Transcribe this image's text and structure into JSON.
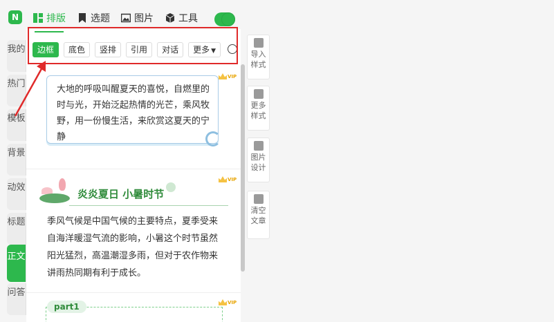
{
  "topbar": {
    "logo": "N",
    "tabs": [
      {
        "label": "排版",
        "icon": "layout-icon",
        "active": true
      },
      {
        "label": "选题",
        "icon": "bookmark-icon",
        "active": false
      },
      {
        "label": "图片",
        "icon": "image-icon",
        "active": false
      },
      {
        "label": "工具",
        "icon": "cube-icon",
        "active": false
      }
    ],
    "toggle_on": true
  },
  "vtabs": [
    {
      "label": "我的",
      "active": false
    },
    {
      "label": "热门",
      "active": false
    },
    {
      "label": "模板",
      "active": false
    },
    {
      "label": "背景",
      "active": false
    },
    {
      "label": "动效",
      "active": false
    },
    {
      "label": "标题",
      "active": false
    },
    {
      "label": "正文",
      "active": true
    },
    {
      "label": "问答",
      "active": false
    }
  ],
  "subtabs": [
    {
      "label": "边框",
      "active": true
    },
    {
      "label": "底色",
      "active": false
    },
    {
      "label": "竖排",
      "active": false
    },
    {
      "label": "引用",
      "active": false
    },
    {
      "label": "对话",
      "active": false
    },
    {
      "label": "更多",
      "active": false,
      "dropdown": true
    }
  ],
  "cards": {
    "card1": {
      "text": "大地的呼吸叫醒夏天的喜悦，自燃里的时与光，开始泛起热情的光芒，乘风牧野，用一份慢生活，来欣赏这夏天的宁静",
      "badge": "VIP"
    },
    "card2": {
      "title": "炎炎夏日 小暑时节",
      "text": "季风气候是中国气候的主要特点，夏季受来自海洋暖湿气流的影响，小暑这个时节虽然阳光猛烈，高温潮湿多雨，但对于农作物来讲雨热同期有利于成长。",
      "badge": "VIP"
    },
    "card3": {
      "tag": "part1",
      "badge": "VIP"
    }
  },
  "tools": [
    {
      "label": "导入样式",
      "icon": "import-icon"
    },
    {
      "label": "更多样式",
      "icon": "grid-icon"
    },
    {
      "label": "图片设计",
      "icon": "image-icon"
    },
    {
      "label": "清空文章",
      "icon": "trash-icon"
    }
  ],
  "colors": {
    "accent": "#2db84d",
    "highlight": "#e02a2a",
    "card_border": "#a8cbe6",
    "title_green": "#2f8b3a",
    "vip": "#e8a400"
  }
}
